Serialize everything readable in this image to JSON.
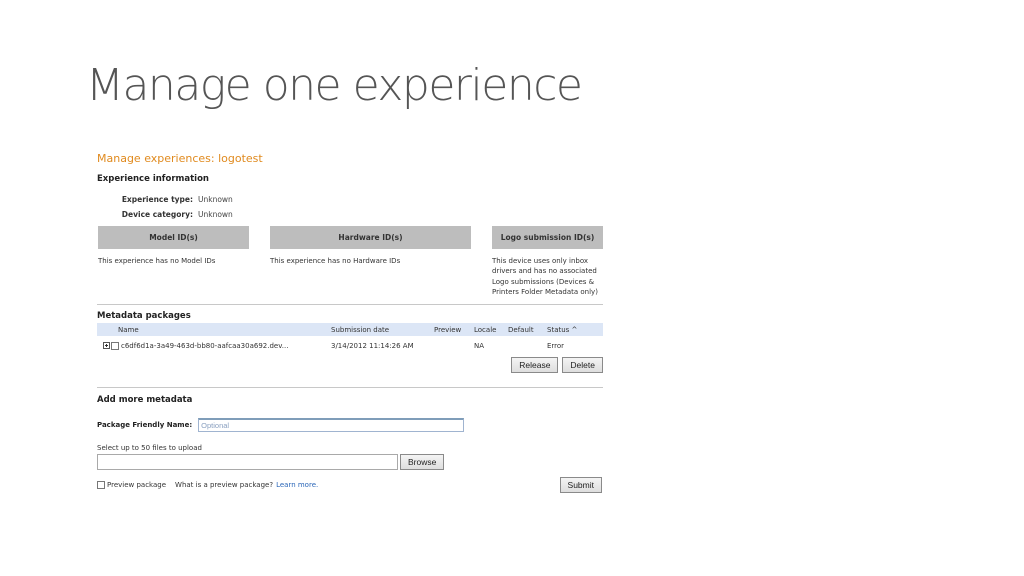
{
  "slide": {
    "title": "Manage one experience"
  },
  "page": {
    "breadcrumb": "Manage experiences: logotest",
    "experience_info": {
      "heading": "Experience information",
      "rows": [
        {
          "label": "Experience type:",
          "value": "Unknown"
        },
        {
          "label": "Device category:",
          "value": "Unknown"
        }
      ]
    },
    "id_columns": [
      {
        "heading": "Model ID(s)",
        "body": "This experience has no Model IDs"
      },
      {
        "heading": "Hardware ID(s)",
        "body": "This experience has no Hardware IDs"
      },
      {
        "heading": "Logo submission ID(s)",
        "body": "This device uses only inbox drivers and has no associated Logo submissions (Devices & Printers Folder Metadata only)"
      }
    ],
    "metadata_packages": {
      "heading": "Metadata packages",
      "columns": {
        "name": "Name",
        "submission_date": "Submission date",
        "preview": "Preview",
        "locale": "Locale",
        "default": "Default",
        "status": "Status ^"
      },
      "rows": [
        {
          "name": "c6df6d1a-3a49-463d-bb80-aafcaa30a692.dev...",
          "submission_date": "3/14/2012 11:14:26 AM",
          "preview": "",
          "locale": "NA",
          "default": "",
          "status": "Error"
        }
      ],
      "release_label": "Release",
      "delete_label": "Delete"
    },
    "add_more": {
      "heading": "Add more metadata",
      "friendly_name_label": "Package Friendly Name:",
      "friendly_name_placeholder": "Optional",
      "upload_label": "Select up to 50  files to upload",
      "browse_label": "Browse",
      "preview_label": "Preview package",
      "preview_question": "What is a preview package?",
      "learn_more": "Learn more.",
      "submit_label": "Submit"
    }
  }
}
